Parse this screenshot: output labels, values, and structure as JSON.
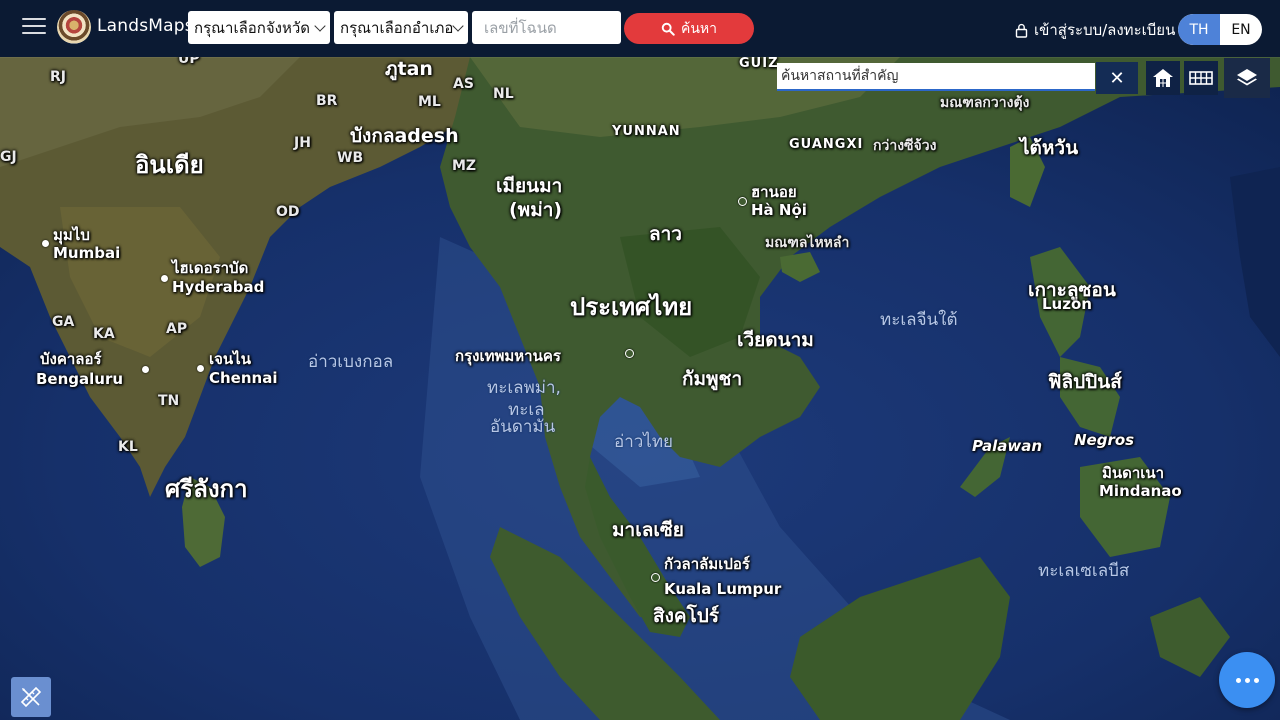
{
  "app": {
    "brand": "LandsMaps"
  },
  "header": {
    "province_select": "กรุณาเลือกจังหวัด",
    "district_select": "กรุณาเลือกอำเภอ",
    "deed_placeholder": "เลขที่โฉนด",
    "search_label": "ค้นหา",
    "login_label": "เข้าสู่ระบบ/ลงทะเบียน",
    "lang_th": "TH",
    "lang_en": "EN",
    "active_lang": "TH"
  },
  "map_controls": {
    "place_search_placeholder": "ค้นหาสถานที่สำคัญ",
    "clear_label": "✕",
    "icons": [
      "home-icon",
      "grid-icon",
      "layers-icon",
      "ruler-pencil-icon",
      "more-icon"
    ]
  },
  "map_labels": {
    "countries": {
      "india": "อินเดีย",
      "bhutan_partial": "ภูtan",
      "bangladesh": "บังกลadesh",
      "myanmar_th": "เมียนมา",
      "myanmar_paren": "(พม่า)",
      "laos": "ลาว",
      "thailand": "ประเทศไทย",
      "vietnam": "เวียดนาม",
      "cambodia": "กัมพูชา",
      "taiwan": "ไต้หวัน",
      "philippines": "ฟิลิปปินส์",
      "malaysia": "มาเลเซีย",
      "sri_lanka": "ศรีลังกา"
    },
    "cities": {
      "mumbai_th": "มุมไบ",
      "mumbai_en": "Mumbai",
      "hyderabad_th": "ไฮเดอราบัด",
      "hyderabad_en": "Hyderabad",
      "bengaluru_th": "บังคาลอร์",
      "bengaluru_en": "Bengaluru",
      "chennai_th": "เจนไน",
      "chennai_en": "Chennai",
      "hanoi_th": "ฮานอย",
      "hanoi_en": "Hà Nội",
      "bangkok": "กรุงเทพมหานคร",
      "kl_th": "กัวลาลัมเปอร์",
      "kl_en": "Kuala Lumpur",
      "singapore": "สิงคโปร์",
      "luzon_th": "เกาะลูซอน",
      "luzon_en": "Luzon",
      "mindanao_th": "มินดาเนา",
      "mindanao_en": "Mindanao",
      "palawan": "Palawan",
      "negros": "Negros"
    },
    "seas": {
      "bay_of_bengal": "อ่าวเบงกอล",
      "andaman_1": "ทะเลพม่า,",
      "andaman_2": "ทะเล",
      "andaman_3": "อันดามัน",
      "gulf_of_thailand": "อ่าวไทย",
      "south_china_sea": "ทะเลจีนใต้",
      "celebes_sea": "ทะเลเซเลบีส"
    },
    "regions": {
      "rj": "RJ",
      "up": "UP",
      "br": "BR",
      "ml": "ML",
      "as": "AS",
      "nl": "NL",
      "jh": "JH",
      "wb": "WB",
      "mz": "MZ",
      "od": "OD",
      "ga": "GA",
      "ka": "KA",
      "ap": "AP",
      "tn": "TN",
      "kl": "KL",
      "gj": "GJ",
      "yunnan": "YUNNAN",
      "guangxi": "GUANGXI",
      "guangxi_th": "กว่างซีจ้วง",
      "guangdong_th": "มณฑลกวางตุ้ง",
      "hainan_th": "มณฑลไหหลำ",
      "guizhou": "GUIZ"
    }
  },
  "colors": {
    "topbar": "#0b1a33",
    "search_button": "#e33a3c",
    "lang_active": "#4e82d8",
    "more_button": "#3b8ff2"
  }
}
